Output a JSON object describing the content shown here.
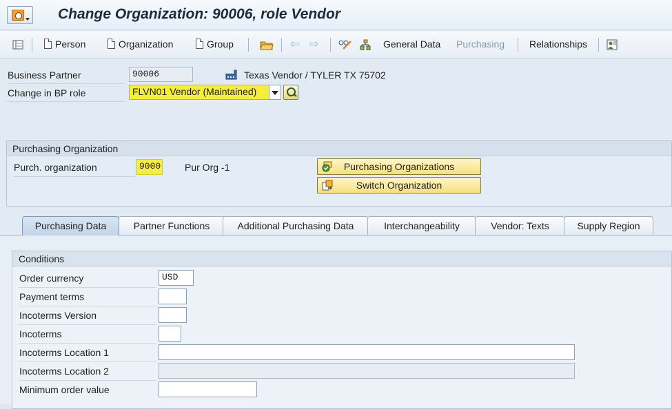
{
  "window": {
    "title": "Change Organization: 90006, role Vendor"
  },
  "toolbar": {
    "person": "Person",
    "organization": "Organization",
    "group": "Group",
    "general_data": "General Data",
    "purchasing": "Purchasing",
    "relationships": "Relationships"
  },
  "header": {
    "bp_label": "Business Partner",
    "bp_value": "90006",
    "bp_description": "Texas Vendor / TYLER TX 75702",
    "role_label": "Change in BP role",
    "role_value": "FLVN01 Vendor (Maintained)"
  },
  "purch_org": {
    "section_title": "Purchasing Organization",
    "label": "Purch. organization",
    "value": "9000",
    "description": "Pur Org -1",
    "btn_orgs": "Purchasing Organizations",
    "btn_switch": "Switch Organization"
  },
  "tabs": [
    {
      "label": "Purchasing Data",
      "active": true
    },
    {
      "label": "Partner Functions"
    },
    {
      "label": "Additional Purchasing Data"
    },
    {
      "label": "Interchangeability"
    },
    {
      "label": "Vendor: Texts"
    },
    {
      "label": "Supply Region"
    }
  ],
  "conditions": {
    "title": "Conditions",
    "order_currency_label": "Order currency",
    "order_currency_value": "USD",
    "payment_terms_label": "Payment terms",
    "payment_terms_value": "",
    "incoterms_version_label": "Incoterms Version",
    "incoterms_version_value": "",
    "incoterms_label": "Incoterms",
    "incoterms_value": "",
    "incoterms_loc1_label": "Incoterms Location 1",
    "incoterms_loc1_value": "",
    "incoterms_loc2_label": "Incoterms Location 2",
    "incoterms_loc2_value": "",
    "min_order_label": "Minimum order value",
    "min_order_value": ""
  },
  "colors": {
    "highlight": "#f5ee4a",
    "button_yellow": "#f6df82",
    "background": "#e2ebf4"
  }
}
